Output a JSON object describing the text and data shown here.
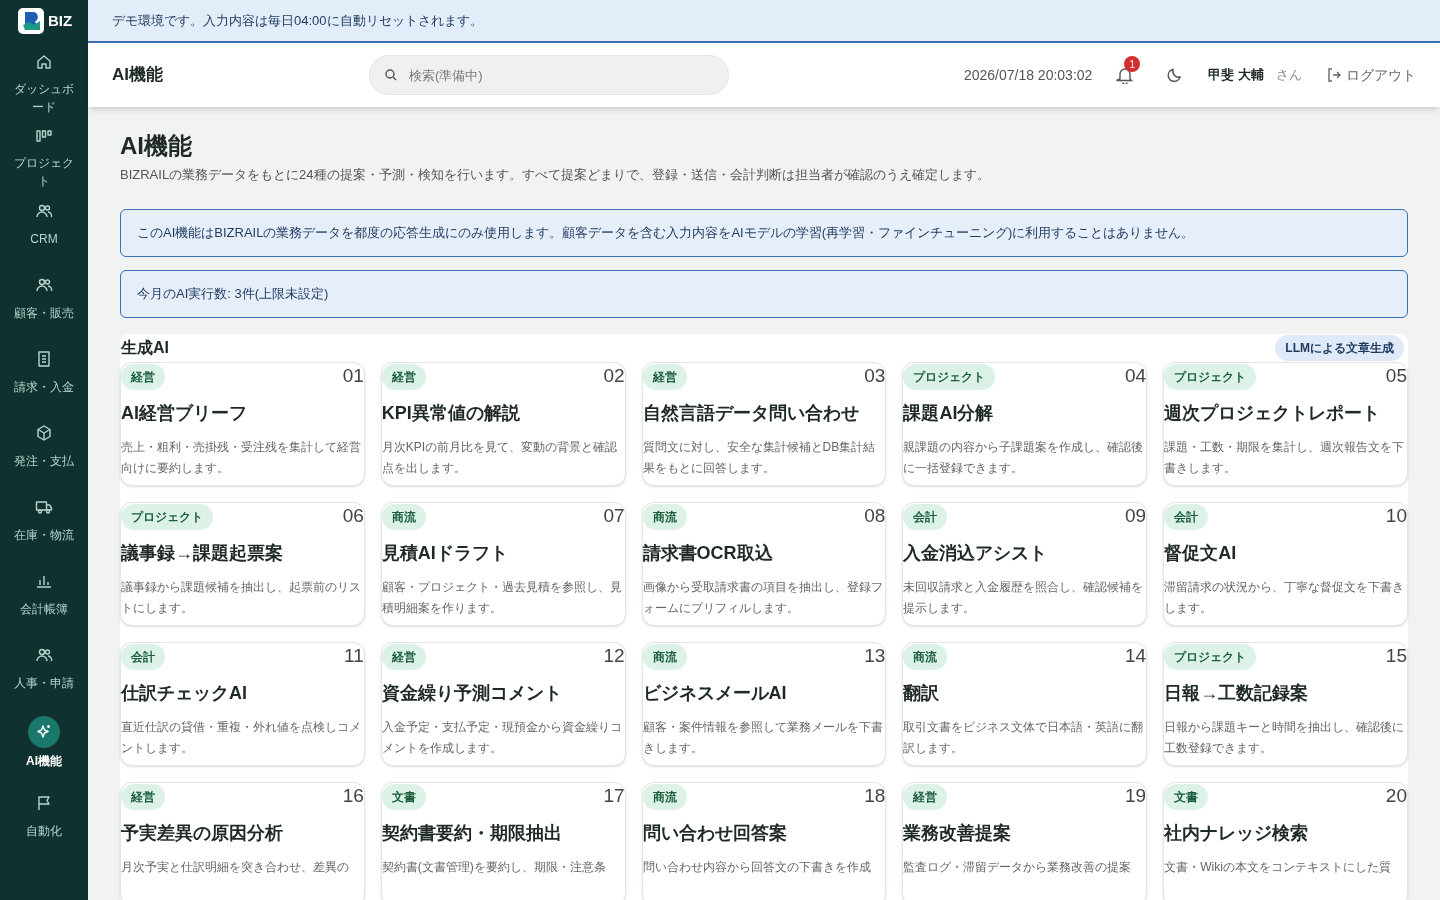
{
  "brand": {
    "text": "BIZ"
  },
  "banner": "デモ環境です。入力内容は毎日04:00に自動リセットされます。",
  "sidebar": {
    "items": [
      {
        "label": "ダッシュボード",
        "selected": false
      },
      {
        "label": "プロジェクト",
        "selected": false
      },
      {
        "label": "CRM",
        "selected": false
      },
      {
        "label": "顧客・販売",
        "selected": false
      },
      {
        "label": "請求・入金",
        "selected": false
      },
      {
        "label": "発注・支払",
        "selected": false
      },
      {
        "label": "在庫・物流",
        "selected": false
      },
      {
        "label": "会計帳簿",
        "selected": false
      },
      {
        "label": "人事・申請",
        "selected": false
      },
      {
        "label": "AI機能",
        "selected": true
      },
      {
        "label": "自動化",
        "selected": false
      }
    ]
  },
  "header": {
    "title": "AI機能",
    "search": {
      "placeholder": "検索(準備中)"
    },
    "datetime": "2026/07/18 20:03:02",
    "notifications": "1",
    "user_name": "甲斐 大輔",
    "user_suffix": "さん",
    "logout": "ログアウト"
  },
  "page": {
    "title": "AI機能",
    "subtitle": "BIZRAILの業務データをもとに24種の提案・予測・検知を行います。すべて提案どまりで、登録・送信・会計判断は担当者が確認のうえ確定します。",
    "notices": [
      "このAI機能はBIZRAILの業務データを都度の応答生成にのみ使用します。顧客データを含む入力内容をAIモデルの学習(再学習・ファインチューニング)に利用することはありません。",
      "今月のAI実行数: 3件(上限未設定)"
    ]
  },
  "section": {
    "title": "生成AI",
    "badge": "LLMによる文章生成",
    "cards": [
      {
        "tag": "経営",
        "number": "01",
        "title": "AI経営ブリーフ",
        "description": "売上・粗利・売掛残・受注残を集計して経営向けに要約します。"
      },
      {
        "tag": "経営",
        "number": "02",
        "title": "KPI異常値の解説",
        "description": "月次KPIの前月比を見て、変動の背景と確認点を出します。"
      },
      {
        "tag": "経営",
        "number": "03",
        "title": "自然言語データ問い合わせ",
        "description": "質問文に対し、安全な集計候補とDB集計結果をもとに回答します。"
      },
      {
        "tag": "プロジェクト",
        "number": "04",
        "title": "課題AI分解",
        "description": "親課題の内容から子課題案を作成し、確認後に一括登録できます。"
      },
      {
        "tag": "プロジェクト",
        "number": "05",
        "title": "週次プロジェクトレポート",
        "description": "課題・工数・期限を集計し、週次報告文を下書きします。"
      },
      {
        "tag": "プロジェクト",
        "number": "06",
        "title": "議事録→課題起票案",
        "description": "議事録から課題候補を抽出し、起票前のリストにします。"
      },
      {
        "tag": "商流",
        "number": "07",
        "title": "見積AIドラフト",
        "description": "顧客・プロジェクト・過去見積を参照し、見積明細案を作ります。"
      },
      {
        "tag": "商流",
        "number": "08",
        "title": "請求書OCR取込",
        "description": "画像から受取請求書の項目を抽出し、登録フォームにプリフィルします。"
      },
      {
        "tag": "会計",
        "number": "09",
        "title": "入金消込アシスト",
        "description": "未回収請求と入金履歴を照合し、確認候補を提示します。"
      },
      {
        "tag": "会計",
        "number": "10",
        "title": "督促文AI",
        "description": "滞留請求の状況から、丁寧な督促文を下書きします。"
      },
      {
        "tag": "会計",
        "number": "11",
        "title": "仕訳チェックAI",
        "description": "直近仕訳の貸借・重複・外れ値を点検しコメントします。"
      },
      {
        "tag": "経営",
        "number": "12",
        "title": "資金繰り予測コメント",
        "description": "入金予定・支払予定・現預金から資金繰りコメントを作成します。"
      },
      {
        "tag": "商流",
        "number": "13",
        "title": "ビジネスメールAI",
        "description": "顧客・案件情報を参照して業務メールを下書きします。"
      },
      {
        "tag": "商流",
        "number": "14",
        "title": "翻訳",
        "description": "取引文書をビジネス文体で日本語・英語に翻訳します。"
      },
      {
        "tag": "プロジェクト",
        "number": "15",
        "title": "日報→工数記録案",
        "description": "日報から課題キーと時間を抽出し、確認後に工数登録できます。"
      },
      {
        "tag": "経営",
        "number": "16",
        "title": "予実差異の原因分析",
        "description": "月次予実と仕訳明細を突き合わせ、差異の"
      },
      {
        "tag": "文書",
        "number": "17",
        "title": "契約書要約・期限抽出",
        "description": "契約書(文書管理)を要約し、期限・注意条"
      },
      {
        "tag": "商流",
        "number": "18",
        "title": "問い合わせ回答案",
        "description": "問い合わせ内容から回答文の下書きを作成"
      },
      {
        "tag": "経営",
        "number": "19",
        "title": "業務改善提案",
        "description": "監査ログ・滞留データから業務改善の提案"
      },
      {
        "tag": "文書",
        "number": "20",
        "title": "社内ナレッジ検索",
        "description": "文書・Wikiの本文をコンテキストにした質"
      }
    ]
  }
}
